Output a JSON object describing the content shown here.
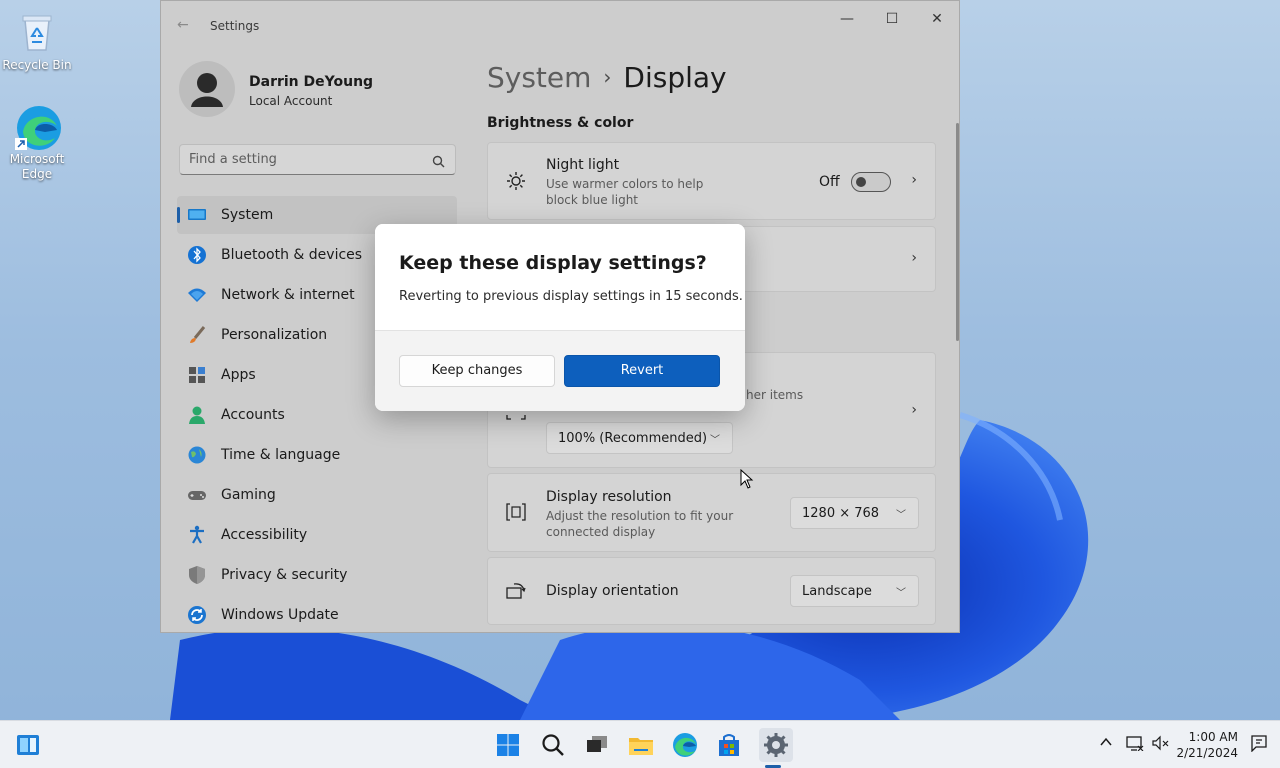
{
  "desktop": {
    "icons": [
      {
        "label": "Recycle Bin",
        "icon": "recycle-bin-icon"
      },
      {
        "label": "Microsoft Edge",
        "icon": "edge-icon"
      }
    ]
  },
  "window": {
    "title": "Settings",
    "controls": {
      "minimize": "minimize-icon",
      "maximize": "maximize-icon",
      "close": "close-icon"
    }
  },
  "profile": {
    "name": "Darrin DeYoung",
    "account": "Local Account"
  },
  "search": {
    "placeholder": "Find a setting"
  },
  "nav": {
    "items": [
      {
        "label": "System",
        "icon": "system-icon",
        "active": true
      },
      {
        "label": "Bluetooth & devices",
        "icon": "bluetooth-icon"
      },
      {
        "label": "Network & internet",
        "icon": "network-icon"
      },
      {
        "label": "Personalization",
        "icon": "brush-icon"
      },
      {
        "label": "Apps",
        "icon": "apps-icon"
      },
      {
        "label": "Accounts",
        "icon": "accounts-icon"
      },
      {
        "label": "Time & language",
        "icon": "globe-icon"
      },
      {
        "label": "Gaming",
        "icon": "gamepad-icon"
      },
      {
        "label": "Accessibility",
        "icon": "accessibility-icon"
      },
      {
        "label": "Privacy & security",
        "icon": "shield-icon"
      },
      {
        "label": "Windows Update",
        "icon": "update-icon"
      }
    ]
  },
  "content": {
    "breadcrumb": {
      "parent": "System",
      "separator": "›",
      "current": "Display"
    },
    "section_brightness": "Brightness & color",
    "night_light": {
      "title": "Night light",
      "description": "Use warmer colors to help block blue light",
      "state": "Off"
    },
    "scale": {
      "desc_fragment": "her items",
      "value": "100% (Recommended)"
    },
    "resolution": {
      "title": "Display resolution",
      "description": "Adjust the resolution to fit your connected display",
      "value": "1280 × 768"
    },
    "orientation": {
      "title": "Display orientation",
      "value": "Landscape"
    }
  },
  "dialog": {
    "title": "Keep these display settings?",
    "message": "Reverting to previous display settings in 15 seconds.",
    "keep_label": "Keep changes",
    "revert_label": "Revert"
  },
  "taskbar": {
    "apps": [
      "start-icon",
      "search-icon",
      "task-view-icon",
      "file-explorer-icon",
      "edge-icon",
      "store-icon",
      "settings-icon"
    ],
    "clock": {
      "time": "1:00 AM",
      "date": "2/21/2024"
    }
  },
  "colors": {
    "accent": "#0d5fbd",
    "nav_indicator": "#1e5fa8"
  }
}
